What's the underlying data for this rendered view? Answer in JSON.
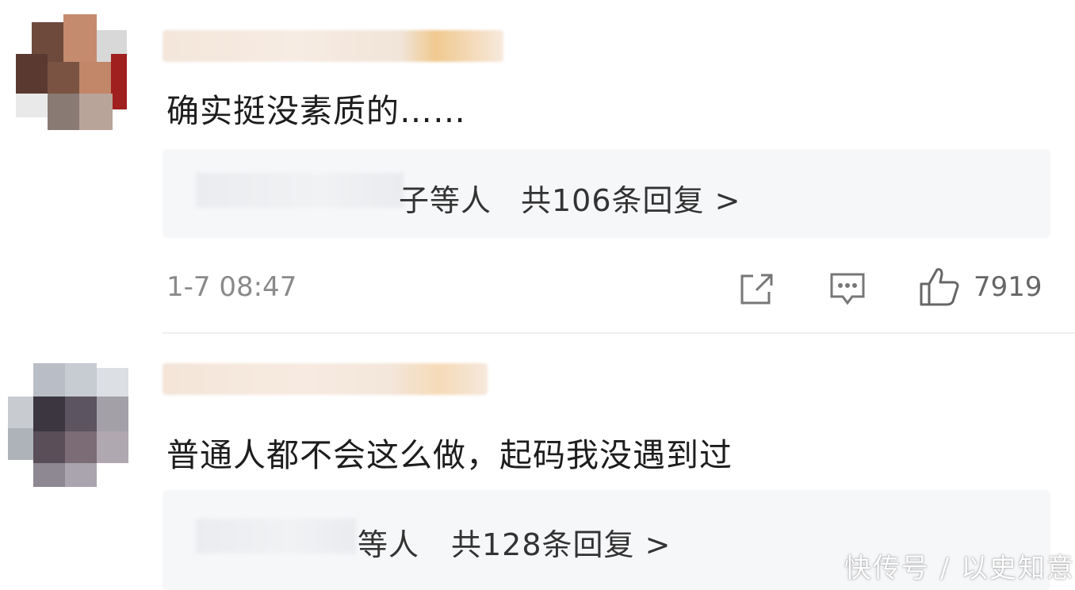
{
  "comments": [
    {
      "text": "确实挺没素质的……",
      "reply_summary": "子等人",
      "reply_count": "共106条回复 >",
      "time": "1-7 08:47",
      "like_count": "7919"
    },
    {
      "text": "普通人都不会这么做，起码我没遇到过",
      "reply_summary": "等人",
      "reply_count": "共128条回复 >"
    }
  ],
  "icons": {
    "share": "share-icon",
    "comment": "comment-icon",
    "like": "thumbs-up-icon"
  },
  "watermark": "快传号 / 以史知意",
  "colors": {
    "text": "#1d1d1d",
    "muted": "#8a8a8a",
    "reply_bg": "#f6f7f9"
  }
}
